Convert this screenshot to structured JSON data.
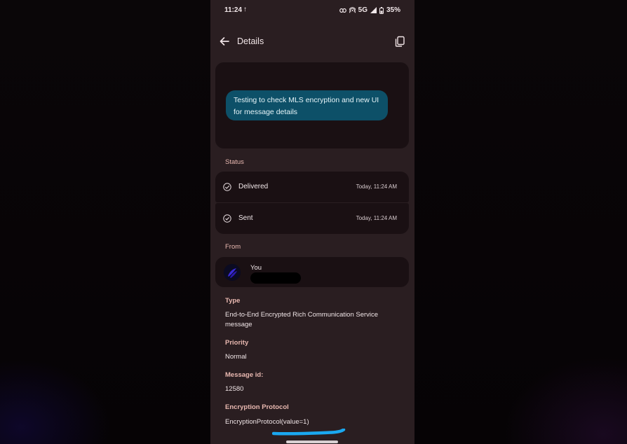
{
  "status_bar": {
    "time": "11:24",
    "upload_indicator": "↑",
    "network": "5G",
    "battery": "35%"
  },
  "app_bar": {
    "title": "Details",
    "back_icon": "arrow-back-icon",
    "copy_icon": "copy-icon"
  },
  "message": {
    "text": "Testing to check MLS encryption and new UI for message details",
    "bubble_color": "#0d5068"
  },
  "status": {
    "label": "Status",
    "rows": [
      {
        "label": "Delivered",
        "time": "Today, 11:24 AM",
        "icon": "check-circle-icon"
      },
      {
        "label": "Sent",
        "time": "Today, 11:24 AM",
        "icon": "check-circle-icon"
      }
    ]
  },
  "from": {
    "label": "From",
    "name": "You"
  },
  "details": {
    "type_label": "Type",
    "type_value": "End-to-End Encrypted Rich Communication Service message",
    "priority_label": "Priority",
    "priority_value": "Normal",
    "message_id_label": "Message id:",
    "message_id_value": "12580",
    "encryption_label": "Encryption Protocol",
    "encryption_value": "EncryptionProtocol(value=1)"
  },
  "colors": {
    "background": "#2a1e21",
    "card": "#1a1013",
    "label_accent": "#e8b8b0",
    "highlight_stroke": "#1aa8f0"
  }
}
